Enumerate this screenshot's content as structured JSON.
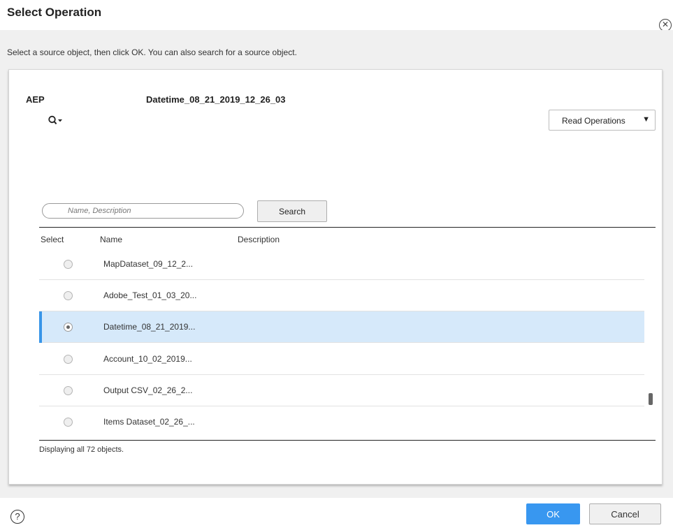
{
  "dialog": {
    "title": "Select Operation",
    "close_glyph": "✕",
    "close_icon": "close-circle-icon",
    "instructions": "Select a source object, then click OK. You can also search for a source object."
  },
  "panel": {
    "connection": "AEP",
    "object_name": "Datetime_08_21_2019_12_26_03",
    "search_toggle_icon": "search-dropdown-icon",
    "operations_select": {
      "value": "Read Operations",
      "arrow": "▼"
    }
  },
  "search": {
    "placeholder": "Name, Description",
    "value": "",
    "button_label": "Search"
  },
  "table": {
    "columns": [
      "Select",
      "Name",
      "Description"
    ],
    "rows": [
      {
        "name": "MapDataset_09_12_2...",
        "description": "",
        "selected": false
      },
      {
        "name": "Adobe_Test_01_03_20...",
        "description": "",
        "selected": false
      },
      {
        "name": "Datetime_08_21_2019...",
        "description": "",
        "selected": true
      },
      {
        "name": "Account_10_02_2019...",
        "description": "",
        "selected": false
      },
      {
        "name": "Output CSV_02_26_2...",
        "description": "",
        "selected": false
      },
      {
        "name": "Items Dataset_02_26_...",
        "description": "",
        "selected": false
      }
    ],
    "status": "Displaying all 72 objects."
  },
  "footer": {
    "help_glyph": "?",
    "help_icon": "help-icon",
    "ok_label": "OK",
    "cancel_label": "Cancel"
  },
  "colors": {
    "primary_button": "#3897f0",
    "selected_row": "#d6e9fa",
    "selected_row_marker": "#3895e8"
  }
}
